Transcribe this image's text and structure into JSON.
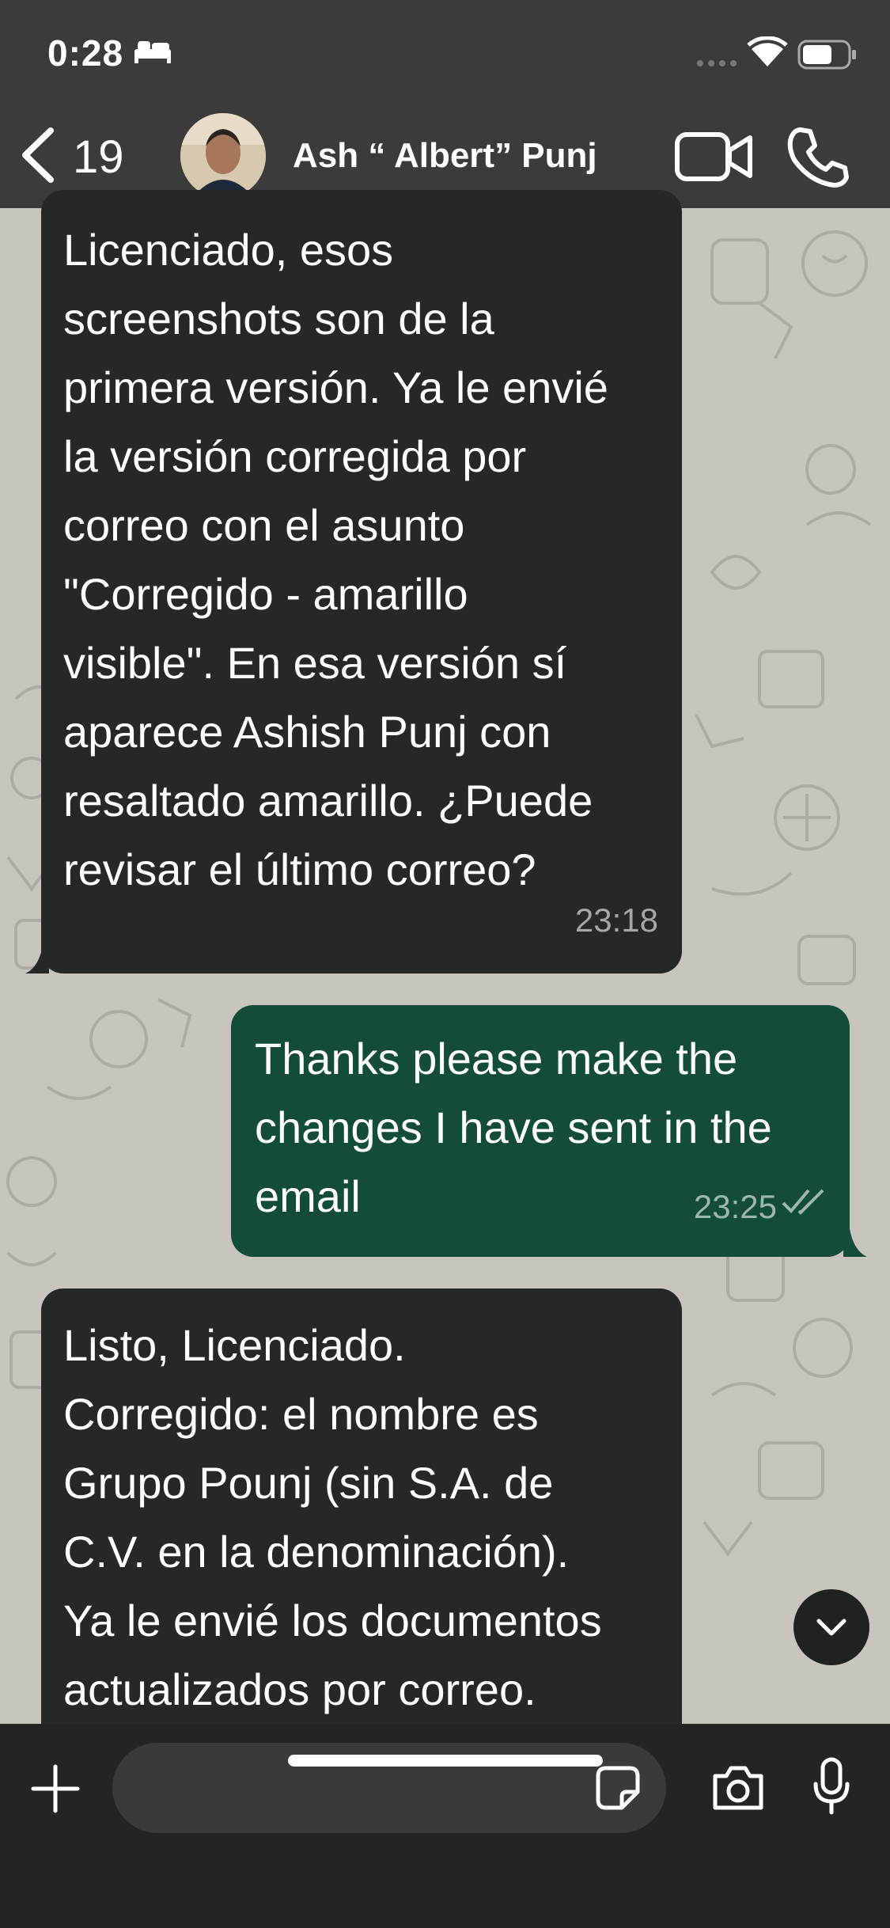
{
  "status_bar": {
    "time": "0:28"
  },
  "header": {
    "back_count": "19",
    "contact_name": "Ash “ Albert” Punj"
  },
  "messages": [
    {
      "direction": "incoming",
      "text": "Licenciado, esos\nscreenshots son de la\nprimera versión. Ya le envié\nla versión corregida por\ncorreo con el asunto\n\"Corregido - amarillo\nvisible\". En esa versión sí\naparece Ashish Punj con\nresaltado amarillo. ¿Puede\nrevisar el último correo?",
      "time": "23:18"
    },
    {
      "direction": "outgoing",
      "text": "Thanks please make the\nchanges I have sent in the\nemail",
      "time": "23:25",
      "status": "read"
    },
    {
      "direction": "incoming",
      "text": "Listo, Licenciado.\nCorregido: el nombre es\nGrupo Pounj (sin S.A. de\nC.V. en la denominación).\nYa le envié los documentos\nactualizados por correo."
    }
  ],
  "input": {
    "placeholder": "",
    "value": ""
  },
  "colors": {
    "header_bg": "#3b3b3b",
    "incoming_bubble": "#262828",
    "outgoing_bubble": "#134d37",
    "wallpaper": "#c8c5bf",
    "input_bar_bg": "#242424"
  },
  "icons": [
    "bed-icon",
    "wifi-icon",
    "battery-icon",
    "chevron-left-icon",
    "video-camera-icon",
    "phone-icon",
    "chevron-down-icon",
    "plus-icon",
    "sticker-icon",
    "camera-icon",
    "microphone-icon",
    "double-check-icon"
  ]
}
